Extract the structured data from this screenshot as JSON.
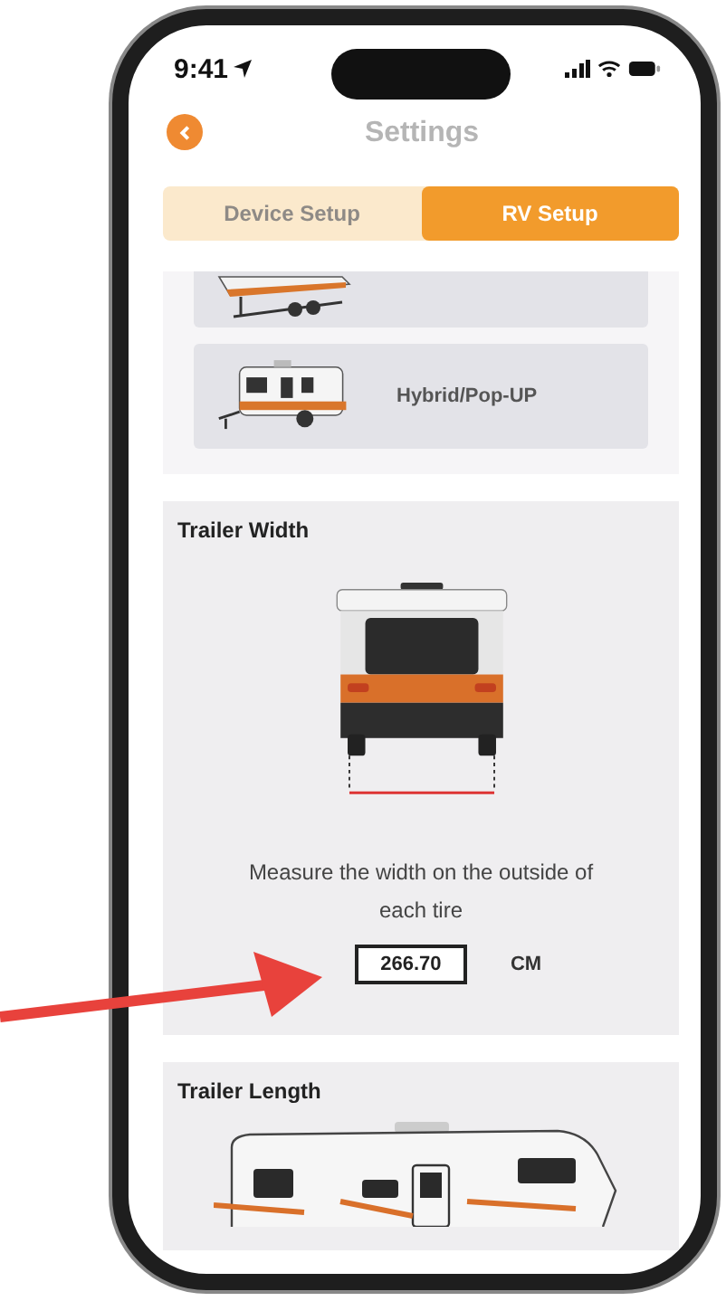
{
  "status_bar": {
    "time": "9:41"
  },
  "header": {
    "title": "Settings"
  },
  "tabs": [
    {
      "label": "Device Setup",
      "selected": false
    },
    {
      "label": "RV Setup",
      "selected": true
    }
  ],
  "rv_types": [
    {
      "kind": "fifth_wheel"
    },
    {
      "kind": "hybrid",
      "label": "Hybrid/Pop-UP"
    }
  ],
  "trailer_width": {
    "title": "Trailer Width",
    "instruction": "Measure the width on the outside of each tire",
    "value": "266.70",
    "unit": "CM"
  },
  "trailer_length": {
    "title": "Trailer Length"
  }
}
